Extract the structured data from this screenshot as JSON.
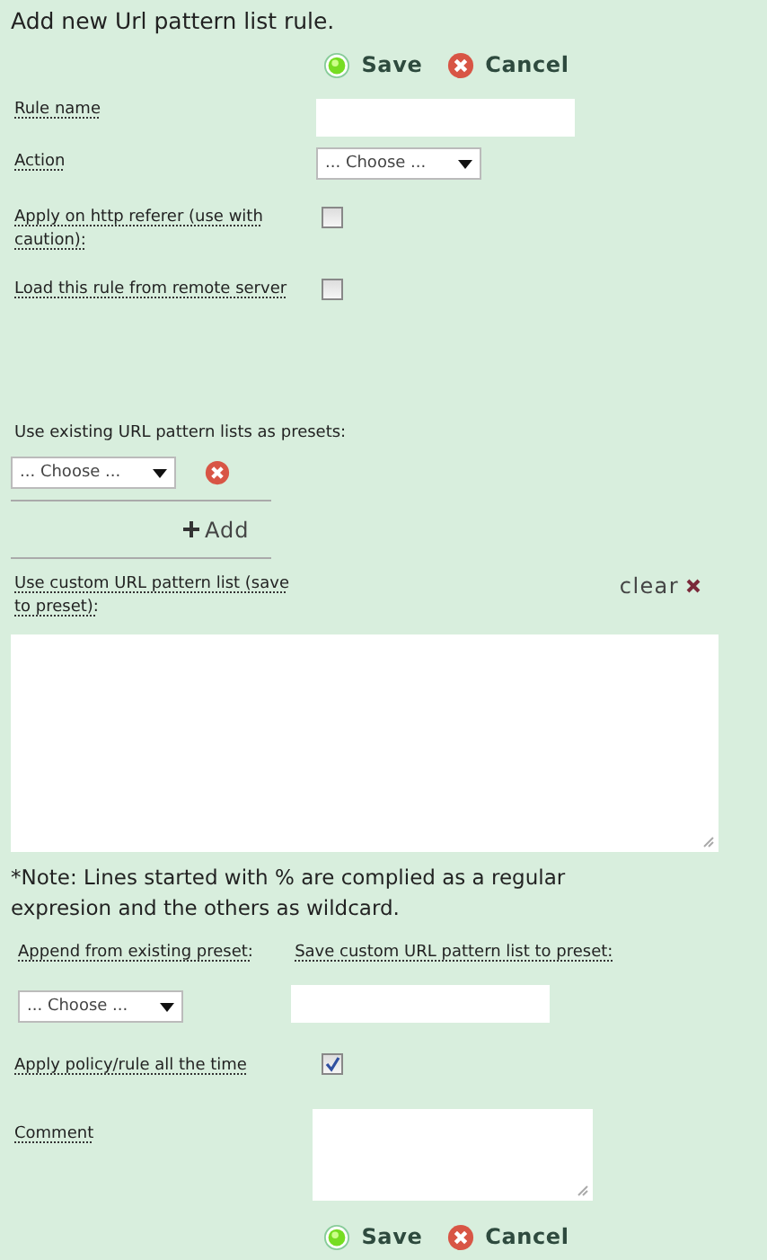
{
  "title": "Add new Url pattern list rule.",
  "top_actions": [
    {
      "kind": "save",
      "label": "Save"
    },
    {
      "kind": "cancel",
      "label": "Cancel"
    }
  ],
  "rule_name": {
    "label": "Rule name"
  },
  "action": {
    "label": "Action",
    "value": "... Choose ..."
  },
  "apply_referer": {
    "label": "Apply on http referer (use with caution):",
    "checked": false
  },
  "load_remote": {
    "label": "Load this rule from remote server",
    "checked": false
  },
  "presets": {
    "label": "Use existing URL pattern lists as presets:",
    "value": "... Choose ...",
    "add": "Add"
  },
  "custom_list": {
    "label": "Use custom URL pattern list (save to preset):",
    "clear": "clear"
  },
  "note": "*Note: Lines started with % are complied as a regular expresion and the others as wildcard.",
  "append": {
    "label": "Append from existing preset:",
    "value": "... Choose ..."
  },
  "save_preset": {
    "label": "Save custom URL pattern list to preset:"
  },
  "apply_always": {
    "label": "Apply policy/rule all the time",
    "checked": true
  },
  "comment": {
    "label": "Comment"
  },
  "bottom_actions": [
    {
      "kind": "save",
      "label": "Save"
    },
    {
      "kind": "cancel",
      "label": "Cancel"
    }
  ]
}
